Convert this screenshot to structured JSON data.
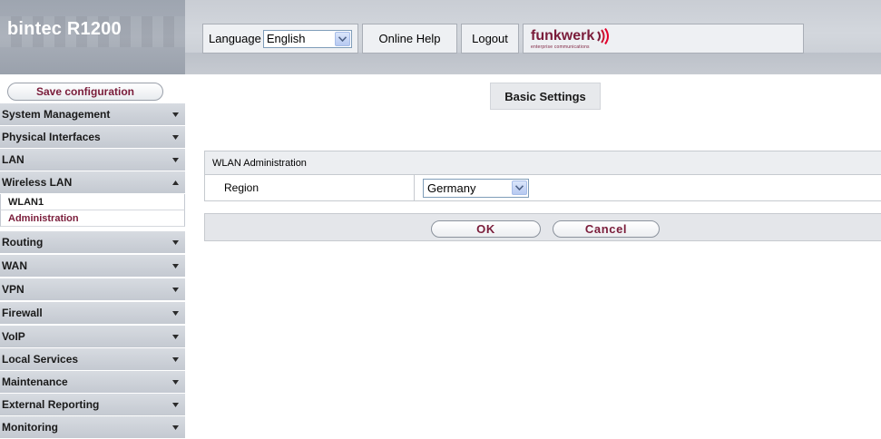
{
  "app": {
    "title": "bintec R1200"
  },
  "header": {
    "language_label": "Language",
    "language_selected": "English",
    "help_label": "Online Help",
    "logout_label": "Logout",
    "logo_text": "funkwerk",
    "logo_subtext": "enterprise communications"
  },
  "sidebar": {
    "save_label": "Save configuration",
    "items": [
      {
        "label": "System Management",
        "icon": "chevron-down-icon"
      },
      {
        "label": "Physical Interfaces",
        "icon": "chevron-down-icon"
      },
      {
        "label": "LAN",
        "icon": "chevron-down-icon"
      },
      {
        "label": "Wireless LAN",
        "icon": "chevron-up-icon",
        "expanded": true
      },
      {
        "label": "Routing",
        "icon": "chevron-down-icon"
      },
      {
        "label": "WAN",
        "icon": "chevron-down-icon"
      },
      {
        "label": "VPN",
        "icon": "chevron-down-icon"
      },
      {
        "label": "Firewall",
        "icon": "chevron-down-icon"
      },
      {
        "label": "VoIP",
        "icon": "chevron-down-icon"
      },
      {
        "label": "Local Services",
        "icon": "chevron-down-icon"
      },
      {
        "label": "Maintenance",
        "icon": "chevron-down-icon"
      },
      {
        "label": "External Reporting",
        "icon": "chevron-down-icon"
      },
      {
        "label": "Monitoring",
        "icon": "chevron-down-icon"
      }
    ],
    "subitems": [
      {
        "label": "WLAN1",
        "active": false
      },
      {
        "label": "Administration",
        "active": true
      }
    ]
  },
  "main": {
    "page_title": "Basic Settings",
    "section_title": "WLAN Administration",
    "region_label": "Region",
    "region_value": "Germany",
    "ok_label": "OK",
    "cancel_label": "Cancel"
  },
  "colors": {
    "accent": "#7a1c3a",
    "nav_bg": "#cdd1d8",
    "header_bg": "#c5c9d0"
  }
}
